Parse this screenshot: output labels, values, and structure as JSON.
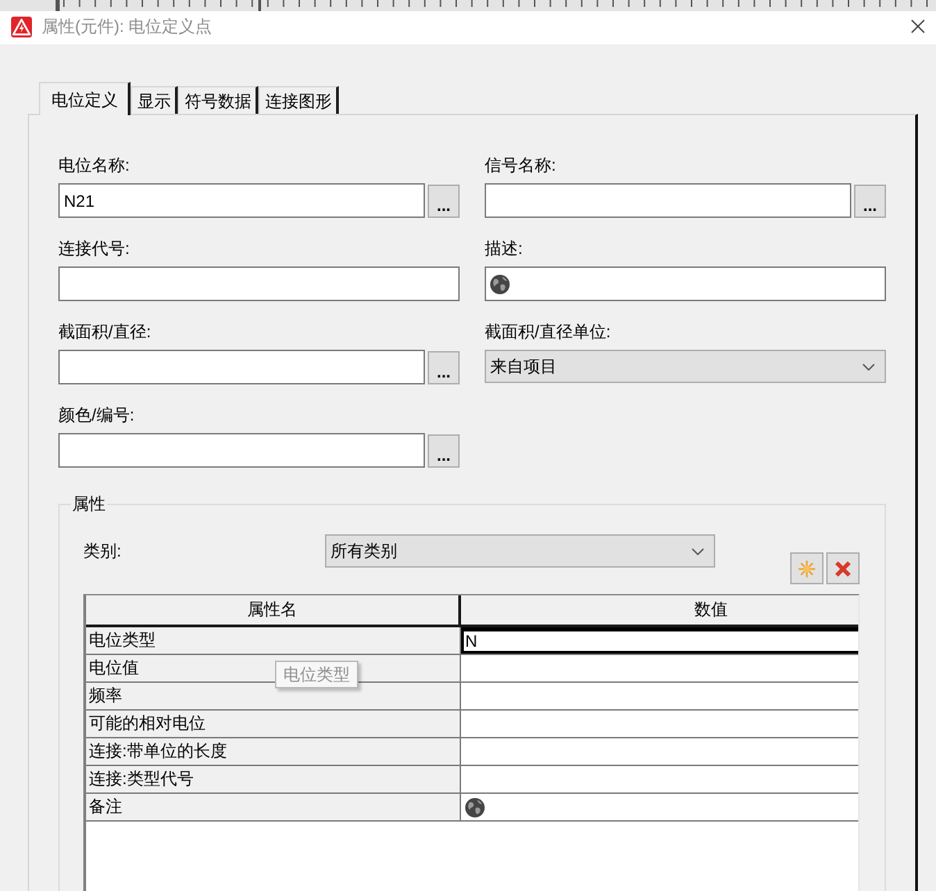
{
  "window": {
    "title": "属性(元件): 电位定义点"
  },
  "tabs": [
    {
      "label": "电位定义",
      "selected": true
    },
    {
      "label": "显示",
      "selected": false
    },
    {
      "label": "符号数据",
      "selected": false
    },
    {
      "label": "连接图形",
      "selected": false
    }
  ],
  "fields": [
    {
      "kind": "browse",
      "label": "电位名称:",
      "value": "N21",
      "button": "..."
    },
    {
      "kind": "browse",
      "label": "信号名称:",
      "button": "..."
    },
    {
      "kind": "text",
      "label": "连接代号:"
    },
    {
      "kind": "translatable",
      "label": "描述:"
    },
    {
      "kind": "browse",
      "label": "截面积/直径:",
      "button": "..."
    },
    {
      "kind": "select",
      "label": "截面积/直径单位:",
      "value": "来自项目"
    },
    {
      "kind": "browse",
      "label": "颜色/编号:",
      "button": "..."
    }
  ],
  "properties": {
    "title": "属性",
    "category": {
      "label": "类别:",
      "value": "所有类别"
    },
    "table": {
      "columns": [
        "属性名",
        "数值"
      ],
      "rows": [
        {
          "name": "电位类型",
          "kind": "text",
          "value": "N",
          "selected": true
        },
        {
          "name": "电位值",
          "kind": "text",
          "selected": false
        },
        {
          "name": "频率",
          "kind": "text",
          "selected": false
        },
        {
          "name": "可能的相对电位",
          "kind": "text",
          "selected": false
        },
        {
          "name": "连接:带单位的长度",
          "kind": "text",
          "selected": false
        },
        {
          "name": "连接:类型代号",
          "kind": "text",
          "selected": false
        },
        {
          "name": "备注",
          "kind": "translatable",
          "selected": false
        }
      ]
    }
  },
  "tooltip": {
    "text": "电位类型"
  }
}
